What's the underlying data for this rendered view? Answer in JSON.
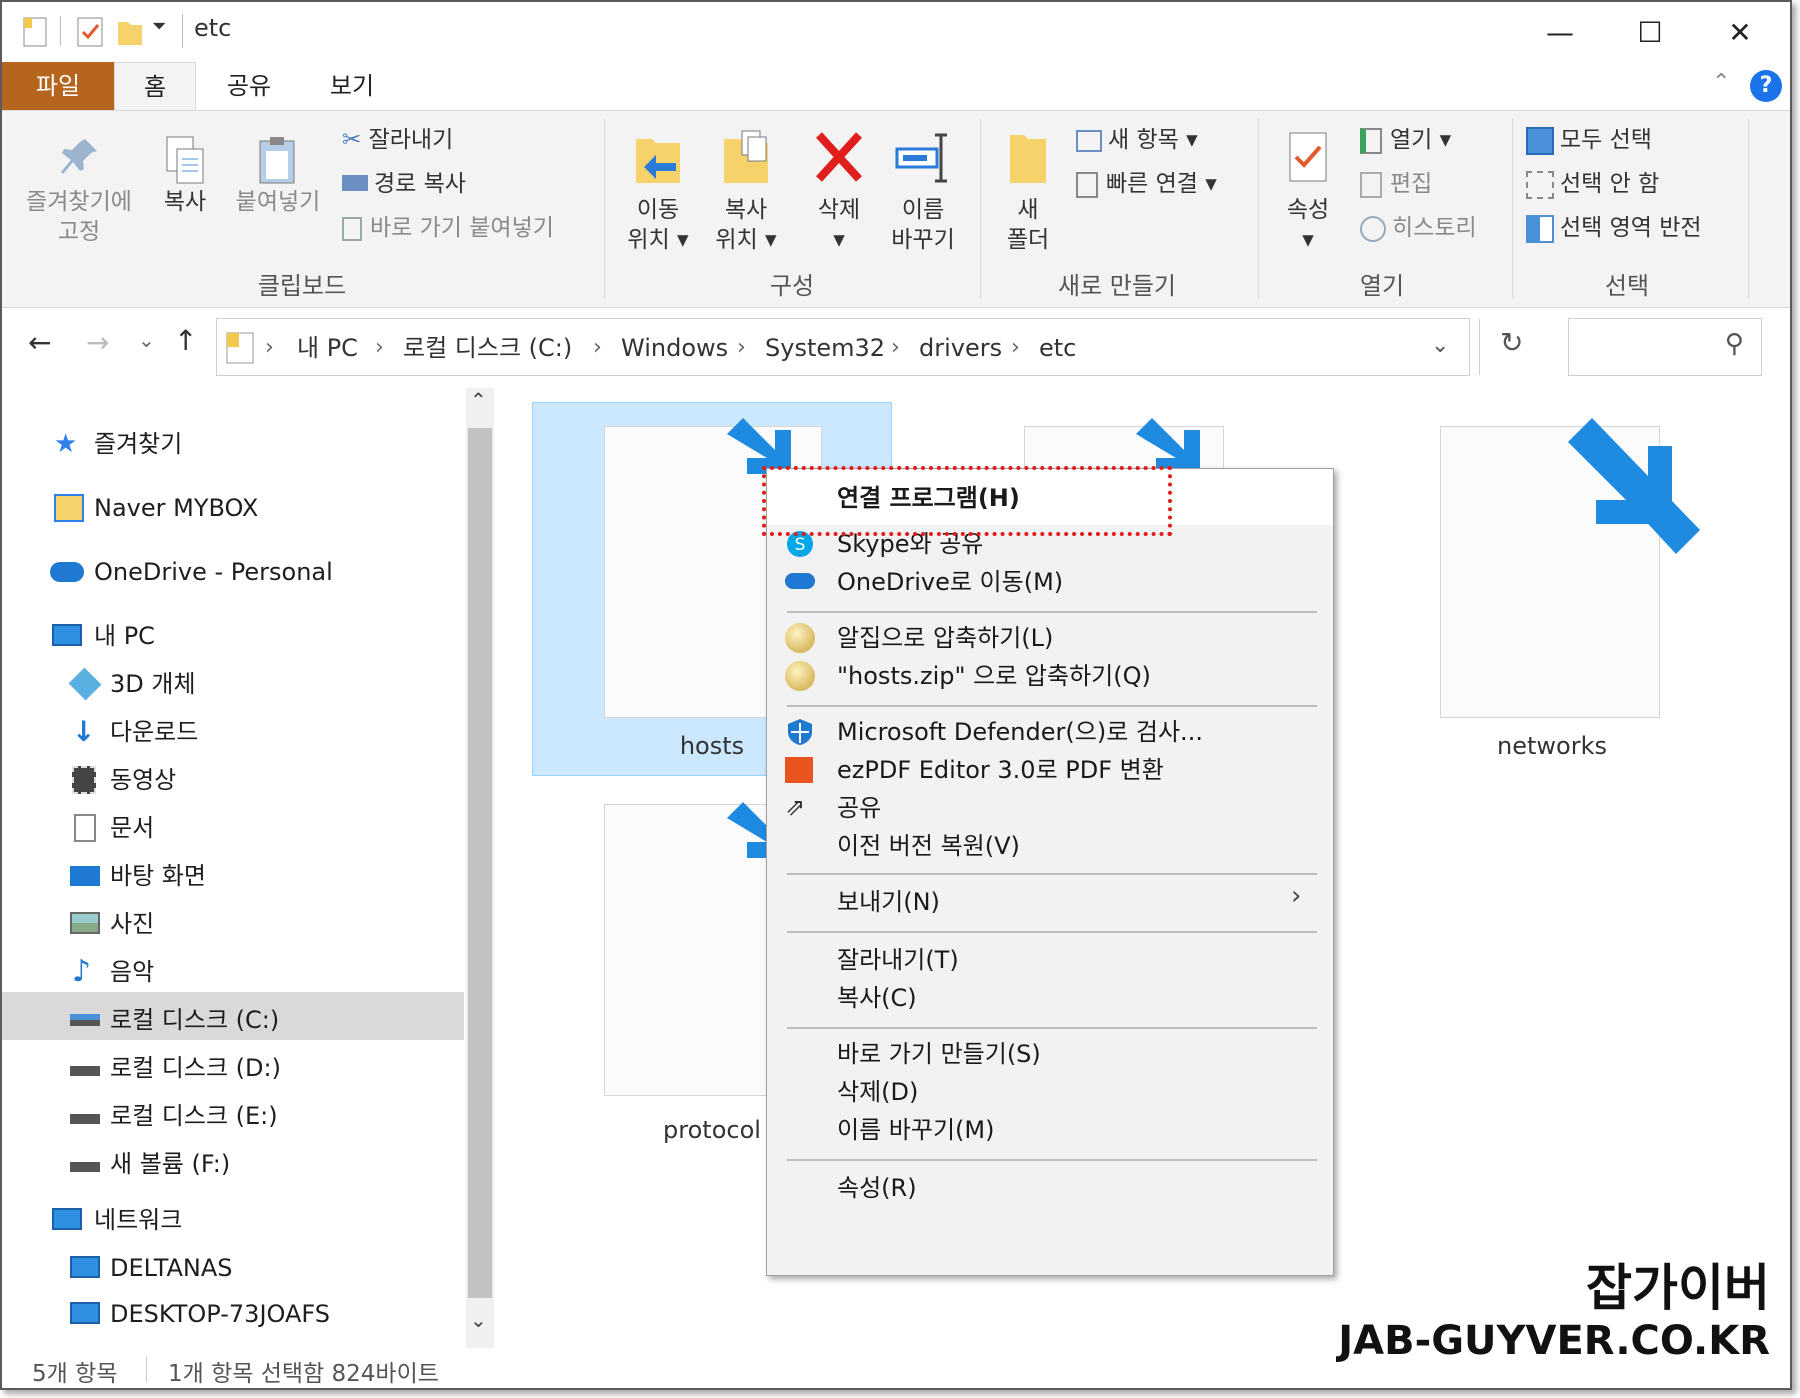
{
  "window": {
    "title": "etc"
  },
  "titlebar": {
    "minimize": "—",
    "maximize": "☐",
    "close": "✕",
    "qat_dropdown": "⏷"
  },
  "tabs": {
    "file": "파일",
    "home": "홈",
    "share": "공유",
    "view": "보기",
    "help": "?"
  },
  "ribbon": {
    "clipboard": {
      "label": "클립보드",
      "pin": [
        "즐겨찾기에",
        "고정"
      ],
      "copy": "복사",
      "paste": "붙여넣기",
      "cut": "잘라내기",
      "copy_path": "경로 복사",
      "paste_shortcut": "바로 가기 붙여넣기"
    },
    "organize": {
      "label": "구성",
      "move_to": [
        "이동",
        "위치 ▾"
      ],
      "copy_to": [
        "복사",
        "위치 ▾"
      ],
      "delete": [
        "삭제",
        "▾"
      ],
      "rename": [
        "이름",
        "바꾸기"
      ]
    },
    "new": {
      "label": "새로 만들기",
      "new_folder": [
        "새",
        "폴더"
      ],
      "new_item": "새 항목 ▾",
      "easy_access": "빠른 연결 ▾"
    },
    "open": {
      "label": "열기",
      "properties": [
        "속성",
        "▾"
      ],
      "open": "열기 ▾",
      "edit": "편집",
      "history": "히스토리"
    },
    "select": {
      "label": "선택",
      "select_all": "모두 선택",
      "select_none": "선택 안 함",
      "invert": "선택 영역 반전"
    }
  },
  "address": {
    "crumbs": [
      "내 PC",
      "로컬 디스크 (C:)",
      "Windows",
      "System32",
      "drivers",
      "etc"
    ],
    "sep": "›"
  },
  "nav": {
    "favorites": "즐겨찾기",
    "mybox": "Naver MYBOX",
    "onedrive": "OneDrive - Personal",
    "mypc": "내 PC",
    "items": [
      "3D 개체",
      "다운로드",
      "동영상",
      "문서",
      "바탕 화면",
      "사진",
      "음악",
      "로컬 디스크 (C:)",
      "로컬 디스크 (D:)",
      "로컬 디스크 (E:)",
      "새 볼륨 (F:)"
    ],
    "network": "네트워크",
    "net_items": [
      "DELTANAS",
      "DESKTOP-73JOAFS"
    ]
  },
  "files": {
    "hosts": "hosts",
    "networks": "networks",
    "protocol": "protocol"
  },
  "context_menu": {
    "open_with": "연결 프로그램(H)",
    "skype": "Skype와 공유",
    "onedrive": "OneDrive로 이동(M)",
    "alzip": "알집으로 압축하기(L)",
    "alzip_named": "\"hosts.zip\" 으로 압축하기(Q)",
    "defender": "Microsoft Defender(으)로 검사...",
    "ezpdf": "ezPDF Editor 3.0로 PDF 변환",
    "share": "공유",
    "restore": "이전 버전 복원(V)",
    "send_to": "보내기(N)",
    "cut": "잘라내기(T)",
    "copy": "복사(C)",
    "shortcut": "바로 가기 만들기(S)",
    "delete": "삭제(D)",
    "rename": "이름 바꾸기(M)",
    "properties": "속성(R)"
  },
  "status": {
    "count": "5개 항목",
    "selected": "1개 항목 선택함 824바이트"
  },
  "watermark": {
    "line1": "잡가이버",
    "line2": "JAB-GUYVER.CO.KR"
  },
  "colors": {
    "file_tab": "#b5651d",
    "highlight": "#e31b1b",
    "selection": "#cce8ff",
    "accent": "#0078d7"
  }
}
